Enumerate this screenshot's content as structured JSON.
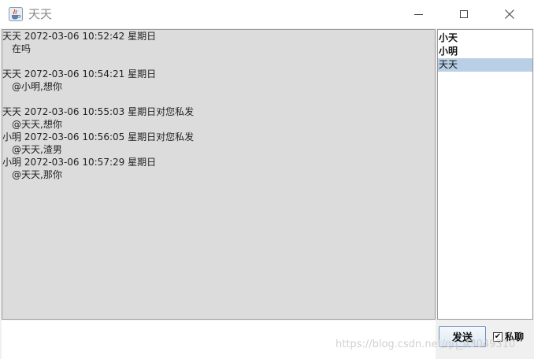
{
  "window": {
    "title": "天天"
  },
  "messages": [
    {
      "header": "天天  2072-03-06 10:52:42 星期日",
      "body": "在吗",
      "gap_after": true
    },
    {
      "header": "天天  2072-03-06 10:54:21 星期日",
      "body": "@小明,想你",
      "gap_after": true
    },
    {
      "header": "天天  2072-03-06 10:55:03 星期日对您私发",
      "body": "@天天,想你",
      "gap_after": false
    },
    {
      "header": "小明  2072-03-06 10:56:05 星期日对您私发",
      "body": "@天天,渣男",
      "gap_after": false
    },
    {
      "header": "小明  2072-03-06 10:57:29 星期日",
      "body": "@天天,那你",
      "gap_after": false
    }
  ],
  "users": [
    {
      "name": "小天",
      "selected": false
    },
    {
      "name": "小明",
      "selected": false
    },
    {
      "name": "天天",
      "selected": true
    }
  ],
  "input": {
    "value": ""
  },
  "send_button": {
    "label": "发送"
  },
  "private_checkbox": {
    "label": "私聊",
    "checked": true,
    "mark": "✔"
  },
  "watermark": {
    "text": "https://blog.csdn.net/qq_43049310"
  },
  "colors": {
    "chat_background": "#dcdcdc",
    "selected_user": "#b8cfe5"
  },
  "icons": {
    "app": "java-cup-icon",
    "minimize": "minimize-icon",
    "maximize": "maximize-icon",
    "close": "close-icon"
  }
}
